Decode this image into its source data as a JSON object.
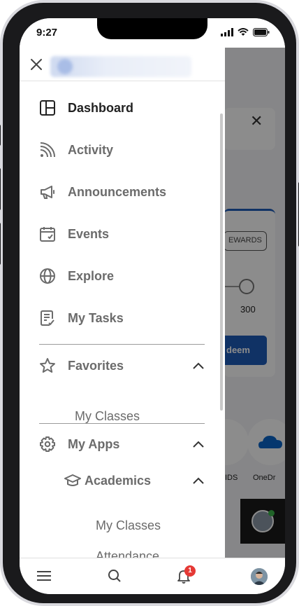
{
  "status_bar": {
    "time": "9:27"
  },
  "background": {
    "rewards_label": "EWARDS",
    "slider_value": "300",
    "redeem_label": "deem",
    "app_labels": [
      "IDS",
      "OneDr"
    ]
  },
  "drawer": {
    "nav_items": [
      {
        "label": "Dashboard",
        "icon": "dashboard-icon",
        "active": true
      },
      {
        "label": "Activity",
        "icon": "rss-feed-icon"
      },
      {
        "label": "Announcements",
        "icon": "megaphone-icon"
      },
      {
        "label": "Events",
        "icon": "calendar-check-icon"
      },
      {
        "label": "Explore",
        "icon": "globe-icon"
      },
      {
        "label": "My Tasks",
        "icon": "task-list-icon"
      }
    ],
    "favorites": {
      "label": "Favorites",
      "icon": "star-icon",
      "items": [
        "My Classes"
      ]
    },
    "my_apps": {
      "label": "My Apps",
      "icon": "gear-icon",
      "academics": {
        "label": "Academics",
        "icon": "graduation-cap-icon",
        "items": [
          "My Classes",
          "Attendance"
        ]
      }
    }
  },
  "bottom_bar": {
    "notification_count": "1"
  },
  "colors": {
    "accent": "#1e5bb8",
    "badge": "#e53935"
  }
}
